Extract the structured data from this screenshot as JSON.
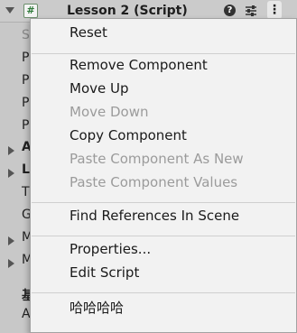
{
  "header": {
    "script_icon_glyph": "#",
    "title": "Lesson 2 (Script)",
    "help_glyph": "?",
    "kebab_glyph": "⋮"
  },
  "background_rows": [
    {
      "label": "S",
      "style": "dim"
    },
    {
      "label": "P"
    },
    {
      "label": "P"
    },
    {
      "label": "P"
    },
    {
      "label": "P"
    },
    {
      "label": "A",
      "style": "bold",
      "arrow": true
    },
    {
      "label": "L",
      "style": "bold",
      "arrow": true
    },
    {
      "label": "T"
    },
    {
      "label": "G"
    },
    {
      "label": "M",
      "arrow": true
    },
    {
      "label": "M",
      "arrow": true
    },
    {
      "label": "基",
      "style": "bold"
    },
    {
      "label": "A"
    }
  ],
  "menu": {
    "items": [
      {
        "label": "Reset",
        "enabled": true
      },
      {
        "label": "Remove Component",
        "enabled": true
      },
      {
        "label": "Move Up",
        "enabled": true
      },
      {
        "label": "Move Down",
        "enabled": false
      },
      {
        "label": "Copy Component",
        "enabled": true
      },
      {
        "label": "Paste Component As New",
        "enabled": false
      },
      {
        "label": "Paste Component Values",
        "enabled": false
      },
      {
        "label": "Find References In Scene",
        "enabled": true
      },
      {
        "label": "Properties...",
        "enabled": true
      },
      {
        "label": "Edit Script",
        "enabled": true
      },
      {
        "label": "哈哈哈哈",
        "enabled": true
      }
    ]
  },
  "icons": {
    "fold": "foldout-arrow-icon",
    "script": "csharp-script-icon",
    "help": "help-icon",
    "presets": "presets-icon",
    "more": "kebab-menu-icon"
  }
}
